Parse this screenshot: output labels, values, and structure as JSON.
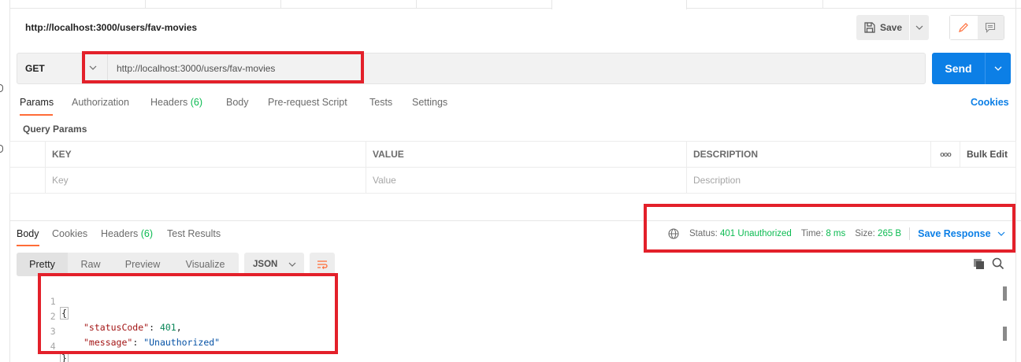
{
  "request": {
    "title": "http://localhost:3000/users/fav-movies",
    "method": "GET",
    "url": "http://localhost:3000/users/fav-movies"
  },
  "toolbar": {
    "save_label": "Save",
    "send_label": "Send"
  },
  "request_tabs": [
    {
      "label": "Params"
    },
    {
      "label": "Authorization"
    },
    {
      "label": "Headers",
      "count": "(6)"
    },
    {
      "label": "Body"
    },
    {
      "label": "Pre-request Script"
    },
    {
      "label": "Tests"
    },
    {
      "label": "Settings"
    }
  ],
  "cookies_label": "Cookies",
  "query_params": {
    "label": "Query Params",
    "headers": [
      "KEY",
      "VALUE",
      "DESCRIPTION"
    ],
    "bulk_edit": "Bulk Edit",
    "more": "ooo",
    "placeholders": [
      "Key",
      "Value",
      "Description"
    ]
  },
  "response_tabs": [
    {
      "label": "Body"
    },
    {
      "label": "Cookies"
    },
    {
      "label": "Headers",
      "count": "(6)"
    },
    {
      "label": "Test Results"
    }
  ],
  "response_status": {
    "status_label": "Status:",
    "status_value": "401 Unauthorized",
    "time_label": "Time:",
    "time_value": "8 ms",
    "size_label": "Size:",
    "size_value": "265 B",
    "save_response": "Save Response"
  },
  "format_tabs": [
    "Pretty",
    "Raw",
    "Preview",
    "Visualize"
  ],
  "format_select": "JSON",
  "response_body": {
    "line_numbers": [
      "1",
      "2",
      "3",
      "4"
    ],
    "open_brace": "{",
    "close_brace": "}",
    "status_key": "\"statusCode\"",
    "status_val": "401",
    "message_key": "\"message\"",
    "message_val": "\"Unauthorized\""
  },
  "colors": {
    "accent_blue": "#0c7fe6",
    "tab_underline": "#ff6c37",
    "success_green": "#0cbb52",
    "highlight_red": "#e3202a"
  }
}
